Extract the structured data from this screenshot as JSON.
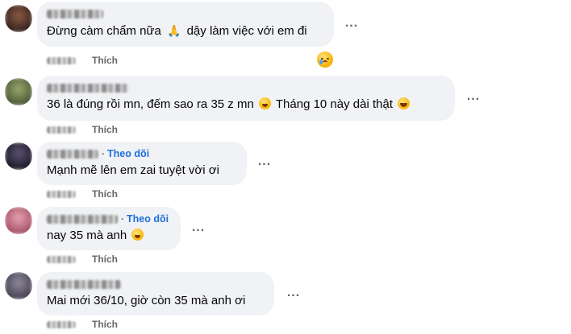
{
  "comments": [
    {
      "follow": "",
      "text_before": "Đừng càm chẩm nữa",
      "text_after": "dậy làm việc với em đi",
      "like_label": "Thích",
      "more": "...",
      "avatar_color": "#5a3a2e"
    },
    {
      "follow": "",
      "text_before": "36 là đúng rồi mn, đếm sao ra 35 z mn",
      "text_middle": "Tháng 10 này dài thật",
      "like_label": "Thích",
      "more": "...",
      "avatar_color": "#7c8a5a"
    },
    {
      "follow": "Theo dõi",
      "text": "Mạnh mẽ lên em zai tuyệt vời ơi",
      "like_label": "Thích",
      "more": "...",
      "avatar_color": "#3a3550"
    },
    {
      "follow": "Theo dõi",
      "text": "nay 35 mà anh",
      "like_label": "Thích",
      "more": "...",
      "avatar_color": "#c96c7c"
    },
    {
      "follow": "",
      "text": "Mai mới 36/10, giờ còn 35 mà anh ơi",
      "like_label": "Thích",
      "more": "...",
      "avatar_color": "#6b6777"
    }
  ],
  "separator": "·"
}
